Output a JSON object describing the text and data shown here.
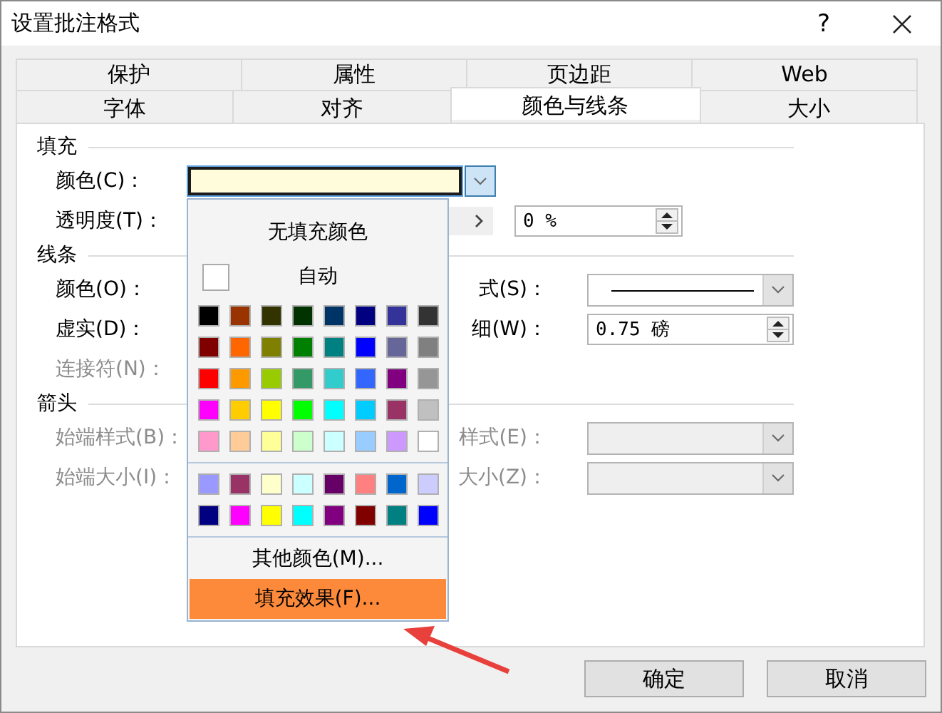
{
  "window": {
    "title": "设置批注格式",
    "help": "?"
  },
  "tab_rows": [
    [
      {
        "label": "保护",
        "selected": false
      },
      {
        "label": "属性",
        "selected": false
      },
      {
        "label": "页边距",
        "selected": false
      },
      {
        "label": "Web",
        "selected": false
      }
    ],
    [
      {
        "label": "字体",
        "selected": false
      },
      {
        "label": "对齐",
        "selected": false
      },
      {
        "label": "颜色与线条",
        "selected": true
      },
      {
        "label": "大小",
        "selected": false
      }
    ]
  ],
  "sections": [
    {
      "title": "填充",
      "rows": [
        {
          "kind": "color",
          "label": "颜色(C)：",
          "disabled": false
        },
        {
          "kind": "transparency",
          "label": "透明度(T)：",
          "disabled": false,
          "value": "0 %"
        }
      ]
    },
    {
      "title": "线条",
      "rows": [
        {
          "kind": "pair",
          "label": "颜色(O)：",
          "disabled": false,
          "right": {
            "label": "式(S)：",
            "disabled": false,
            "kind": "line_style"
          }
        },
        {
          "kind": "pair",
          "label": "虚实(D)：",
          "disabled": false,
          "right": {
            "label": "细(W)：",
            "disabled": false,
            "kind": "spin",
            "value": "0.75 磅"
          }
        },
        {
          "kind": "pair",
          "label": "连接符(N)：",
          "disabled": true
        }
      ]
    },
    {
      "title": "箭头",
      "rows": [
        {
          "kind": "pair",
          "label": "始端样式(B)：",
          "disabled": true,
          "right": {
            "label": "样式(E)：",
            "disabled": true,
            "kind": "dropdown"
          }
        },
        {
          "kind": "pair",
          "label": "始端大小(I)：",
          "disabled": true,
          "right": {
            "label": "大小(Z)：",
            "disabled": true,
            "kind": "dropdown"
          }
        }
      ]
    }
  ],
  "popup": {
    "no_fill": "无填充颜色",
    "auto": "自动",
    "palette": [
      {
        "color": "#000000"
      },
      {
        "color": "#993300"
      },
      {
        "color": "#333300"
      },
      {
        "color": "#003300"
      },
      {
        "color": "#003366"
      },
      {
        "color": "#000080"
      },
      {
        "color": "#333399"
      },
      {
        "color": "#333333"
      },
      {
        "color": "#800000"
      },
      {
        "color": "#ff6600"
      },
      {
        "color": "#808000"
      },
      {
        "color": "#008000"
      },
      {
        "color": "#008080"
      },
      {
        "color": "#0000ff"
      },
      {
        "color": "#666699"
      },
      {
        "color": "#808080"
      },
      {
        "color": "#ff0000"
      },
      {
        "color": "#ff9900"
      },
      {
        "color": "#99cc00"
      },
      {
        "color": "#339966"
      },
      {
        "color": "#33cccc"
      },
      {
        "color": "#3366ff"
      },
      {
        "color": "#800080"
      },
      {
        "color": "#969696"
      },
      {
        "color": "#ff00ff"
      },
      {
        "color": "#ffcc00"
      },
      {
        "color": "#ffff00"
      },
      {
        "color": "#00ff00"
      },
      {
        "color": "#00ffff"
      },
      {
        "color": "#00ccff"
      },
      {
        "color": "#993366"
      },
      {
        "color": "#c0c0c0"
      },
      {
        "color": "#ff99cc"
      },
      {
        "color": "#ffcc99"
      },
      {
        "color": "#ffff99"
      },
      {
        "color": "#ccffcc"
      },
      {
        "color": "#ccffff"
      },
      {
        "color": "#99ccff"
      },
      {
        "color": "#cc99ff"
      },
      {
        "color": "#ffffff"
      }
    ],
    "recent": [
      {
        "color": "#9999ff"
      },
      {
        "color": "#993366"
      },
      {
        "color": "#ffffcc"
      },
      {
        "color": "#ccffff"
      },
      {
        "color": "#660066"
      },
      {
        "color": "#ff8080"
      },
      {
        "color": "#0066cc"
      },
      {
        "color": "#ccccff"
      },
      {
        "color": "#000080"
      },
      {
        "color": "#ff00ff"
      },
      {
        "color": "#ffff00"
      },
      {
        "color": "#00ffff"
      },
      {
        "color": "#800080"
      },
      {
        "color": "#800000"
      },
      {
        "color": "#008080"
      },
      {
        "color": "#0000ff"
      }
    ],
    "items": [
      {
        "label": "其他颜色(M)...",
        "highlighted": false
      },
      {
        "label": "填充效果(F)...",
        "highlighted": true
      }
    ]
  },
  "buttons": [
    "确定",
    "取消"
  ]
}
